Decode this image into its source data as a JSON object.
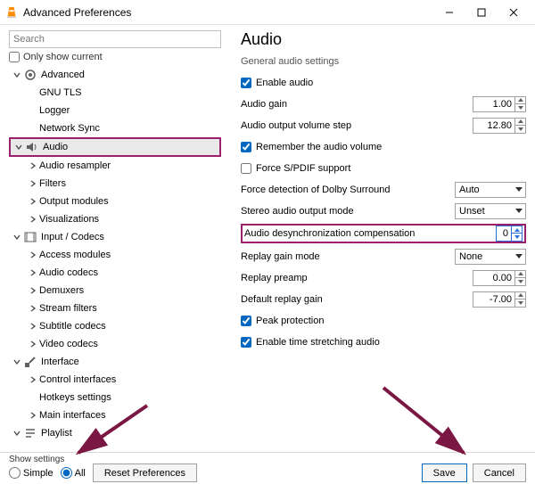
{
  "window": {
    "title": "Advanced Preferences"
  },
  "left": {
    "search_placeholder": "Search",
    "only_current": "Only show current",
    "tree": {
      "advanced": "Advanced",
      "gnu_tls": "GNU TLS",
      "logger": "Logger",
      "network_sync": "Network Sync",
      "audio": "Audio",
      "audio_resampler": "Audio resampler",
      "filters": "Filters",
      "output_modules": "Output modules",
      "visualizations": "Visualizations",
      "input_codecs": "Input / Codecs",
      "access_modules": "Access modules",
      "audio_codecs": "Audio codecs",
      "demuxers": "Demuxers",
      "stream_filters": "Stream filters",
      "subtitle_codecs": "Subtitle codecs",
      "video_codecs": "Video codecs",
      "interface": "Interface",
      "control_interfaces": "Control interfaces",
      "hotkeys_settings": "Hotkeys settings",
      "main_interfaces": "Main interfaces",
      "playlist": "Playlist"
    }
  },
  "right": {
    "heading": "Audio",
    "section": "General audio settings",
    "labels": {
      "enable_audio": "Enable audio",
      "audio_gain": "Audio gain",
      "vol_step": "Audio output volume step",
      "remember_vol": "Remember the audio volume",
      "force_spdif": "Force S/PDIF support",
      "dolby": "Force detection of Dolby Surround",
      "stereo_mode": "Stereo audio output mode",
      "desync": "Audio desynchronization compensation",
      "replay_gain_mode": "Replay gain mode",
      "replay_preamp": "Replay preamp",
      "default_replay_gain": "Default replay gain",
      "peak_protection": "Peak protection",
      "time_stretch": "Enable time stretching audio"
    },
    "values": {
      "audio_gain": "1.00",
      "vol_step": "12.80",
      "dolby": "Auto",
      "stereo_mode": "Unset",
      "desync": "0",
      "replay_gain_mode": "None",
      "replay_preamp": "0.00",
      "default_replay_gain": "-7.00"
    }
  },
  "footer": {
    "show_settings": "Show settings",
    "simple": "Simple",
    "all": "All",
    "reset": "Reset Preferences",
    "save": "Save",
    "cancel": "Cancel"
  }
}
